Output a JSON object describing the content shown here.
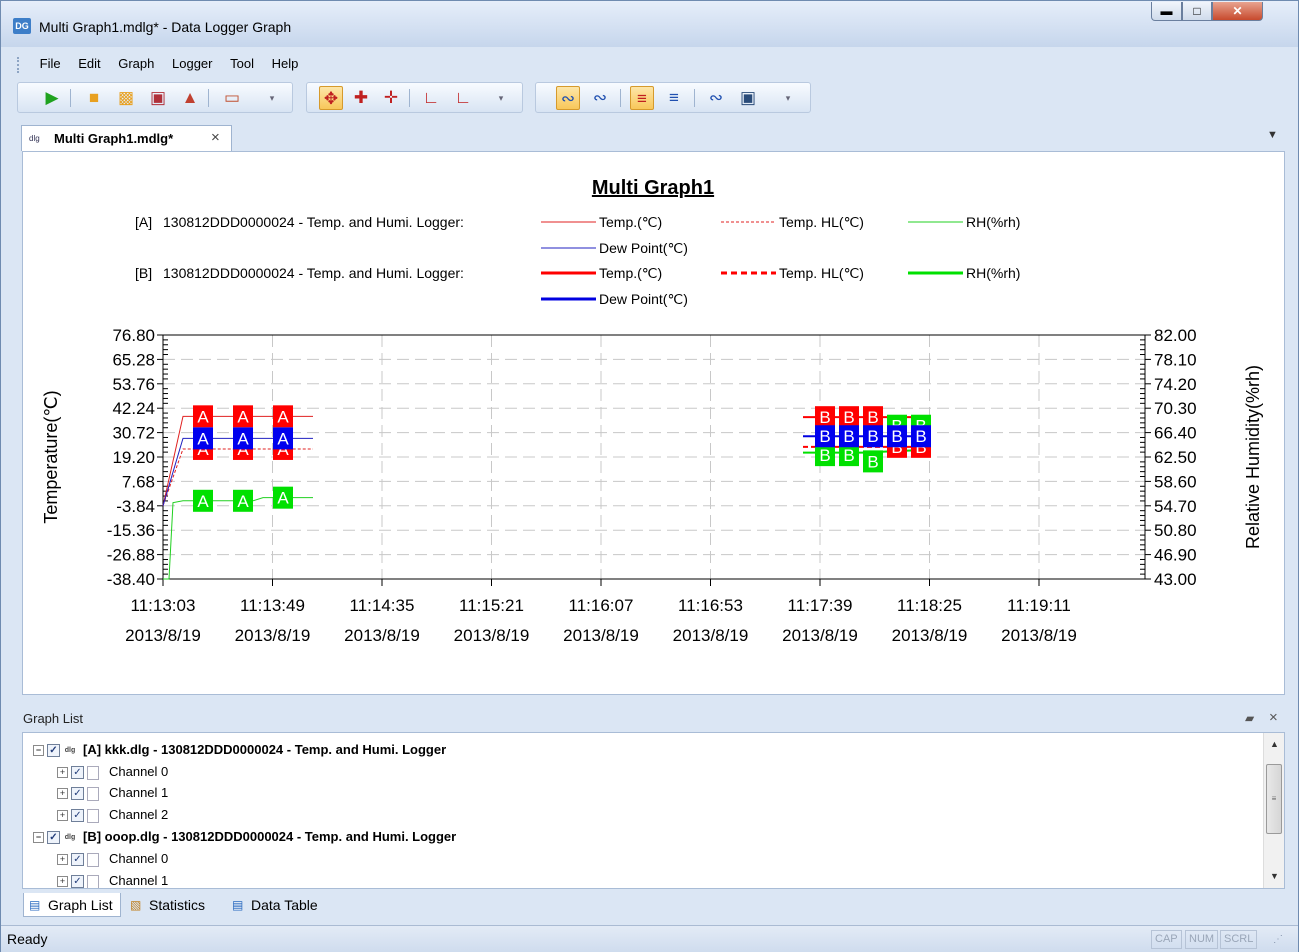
{
  "window": {
    "title": "Multi Graph1.mdlg* - Data Logger Graph",
    "app_icon_text": "DG"
  },
  "menu": [
    "File",
    "Edit",
    "Graph",
    "Logger",
    "Tool",
    "Help"
  ],
  "toolbars": {
    "file_icons": [
      "play-icon",
      "open-folder-icon",
      "open-multi-folder-icon",
      "save-icon",
      "upload-icon",
      "window-icon"
    ],
    "zoom_icons": [
      "move-icon",
      "pan-horizontal-icon",
      "pan-vertical-icon",
      "zoom-in-icon",
      "zoom-out-icon"
    ],
    "view_icons": [
      "graph-style-1-icon",
      "graph-style-2-icon",
      "graph-style-3-icon",
      "graph-style-4-icon",
      "graph-style-5-icon",
      "graph-style-6-icon"
    ]
  },
  "document_tab": {
    "label": "Multi Graph1.mdlg*",
    "icon_text": "dlg"
  },
  "chart_data": {
    "type": "line",
    "title": "Multi Graph1",
    "ylabel": "Temperature(℃)",
    "y2label": "Relative Humidity(%rh)",
    "ylim": [
      -38.4,
      76.8
    ],
    "y2lim": [
      43.0,
      82.0
    ],
    "y_ticks": [
      "76.80",
      "65.28",
      "53.76",
      "42.24",
      "30.72",
      "19.20",
      "7.68",
      "-3.84",
      "-15.36",
      "-26.88",
      "-38.40"
    ],
    "y2_ticks": [
      "82.00",
      "78.10",
      "74.20",
      "70.30",
      "66.40",
      "62.50",
      "58.60",
      "54.70",
      "50.80",
      "46.90",
      "43.00"
    ],
    "x_ticks": [
      {
        "time": "11:13:03",
        "date": "2013/8/19"
      },
      {
        "time": "11:13:49",
        "date": "2013/8/19"
      },
      {
        "time": "11:14:35",
        "date": "2013/8/19"
      },
      {
        "time": "11:15:21",
        "date": "2013/8/19"
      },
      {
        "time": "11:16:07",
        "date": "2013/8/19"
      },
      {
        "time": "11:16:53",
        "date": "2013/8/19"
      },
      {
        "time": "11:17:39",
        "date": "2013/8/19"
      },
      {
        "time": "11:18:25",
        "date": "2013/8/19"
      },
      {
        "time": "11:19:11",
        "date": "2013/8/19"
      }
    ],
    "grid": true,
    "legend_groups": [
      {
        "prefix": "[A]",
        "source": "130812DDD0000024 - Temp. and Humi. Logger:",
        "series": [
          {
            "name": "Temp.(℃)",
            "color": "#e02020",
            "style": "solid"
          },
          {
            "name": "Temp. HL(℃)",
            "color": "#e02020",
            "style": "dashed"
          },
          {
            "name": "RH(%rh)",
            "color": "#20d020",
            "style": "solid"
          },
          {
            "name": "Dew Point(℃)",
            "color": "#2020c0",
            "style": "solid"
          }
        ]
      },
      {
        "prefix": "[B]",
        "source": "130812DDD0000024 - Temp. and Humi. Logger:",
        "series": [
          {
            "name": "Temp.(℃)",
            "color": "#ff0000",
            "style": "solid"
          },
          {
            "name": "Temp. HL(℃)",
            "color": "#ff0000",
            "style": "dashed"
          },
          {
            "name": "RH(%rh)",
            "color": "#00e000",
            "style": "solid"
          },
          {
            "name": "Dew Point(℃)",
            "color": "#0000e0",
            "style": "solid"
          }
        ]
      }
    ],
    "series": [
      {
        "group": "A",
        "name": "Temp.(℃)",
        "color": "#e02020",
        "width": 1,
        "dash": "",
        "x": [
          0,
          20,
          150
        ],
        "y": [
          -3.84,
          38.4,
          38.4
        ]
      },
      {
        "group": "A",
        "name": "Temp. HL(℃)",
        "color": "#e02020",
        "width": 1,
        "dash": "3,2",
        "x": [
          0,
          20,
          150
        ],
        "y": [
          -3.84,
          23.0,
          23.0
        ]
      },
      {
        "group": "A",
        "name": "Dew Point(℃)",
        "color": "#2020c0",
        "width": 1,
        "dash": "",
        "x": [
          0,
          20,
          150
        ],
        "y": [
          -3.84,
          28.0,
          28.0
        ]
      },
      {
        "group": "A",
        "name": "RH(%rh)",
        "color": "#20d020",
        "width": 1,
        "dash": "",
        "x": [
          0,
          6,
          10,
          20,
          90,
          100,
          150
        ],
        "y": [
          43.0,
          43.0,
          55.2,
          55.5,
          55.5,
          56.0,
          56.0
        ]
      },
      {
        "group": "B",
        "name": "Temp.(℃)",
        "color": "#ff0000",
        "width": 2,
        "dash": "",
        "x": [
          640,
          756
        ],
        "y": [
          38.0,
          38.0
        ]
      },
      {
        "group": "B",
        "name": "Temp. HL(℃)",
        "color": "#ff0000",
        "width": 2,
        "dash": "5,3",
        "x": [
          640,
          756
        ],
        "y": [
          24.0,
          24.0
        ]
      },
      {
        "group": "B",
        "name": "Dew Point(℃)",
        "color": "#0000e0",
        "width": 2,
        "dash": "",
        "x": [
          640,
          756
        ],
        "y": [
          29.0,
          29.0
        ]
      },
      {
        "group": "B",
        "name": "RH(%rh)",
        "color": "#00e000",
        "width": 2,
        "dash": "",
        "x": [
          640,
          700,
          756
        ],
        "y": [
          63.2,
          63.2,
          63.6
        ]
      }
    ],
    "markers": [
      {
        "label": "A",
        "color": "#ff0000",
        "axis": "left",
        "x": 40,
        "y": 38.4
      },
      {
        "label": "A",
        "color": "#ff0000",
        "axis": "left",
        "x": 80,
        "y": 38.4
      },
      {
        "label": "A",
        "color": "#ff0000",
        "axis": "left",
        "x": 120,
        "y": 38.4
      },
      {
        "label": "A",
        "color": "#ff0000",
        "axis": "left",
        "x": 40,
        "y": 23.0
      },
      {
        "label": "A",
        "color": "#ff0000",
        "axis": "left",
        "x": 80,
        "y": 23.0
      },
      {
        "label": "A",
        "color": "#ff0000",
        "axis": "left",
        "x": 120,
        "y": 23.0
      },
      {
        "label": "A",
        "color": "#0000ee",
        "axis": "left",
        "x": 40,
        "y": 28.0
      },
      {
        "label": "A",
        "color": "#0000ee",
        "axis": "left",
        "x": 80,
        "y": 28.0
      },
      {
        "label": "A",
        "color": "#0000ee",
        "axis": "left",
        "x": 120,
        "y": 28.0
      },
      {
        "label": "A",
        "color": "#00e000",
        "axis": "right",
        "x": 40,
        "y": 55.5
      },
      {
        "label": "A",
        "color": "#00e000",
        "axis": "right",
        "x": 80,
        "y": 55.5
      },
      {
        "label": "A",
        "color": "#00e000",
        "axis": "right",
        "x": 120,
        "y": 56.0
      },
      {
        "label": "B",
        "color": "#ff0000",
        "axis": "left",
        "x": 662,
        "y": 38.0
      },
      {
        "label": "B",
        "color": "#ff0000",
        "axis": "left",
        "x": 686,
        "y": 38.0
      },
      {
        "label": "B",
        "color": "#ff0000",
        "axis": "left",
        "x": 710,
        "y": 38.0
      },
      {
        "label": "B",
        "color": "#ff0000",
        "axis": "left",
        "x": 734,
        "y": 24.0
      },
      {
        "label": "B",
        "color": "#ff0000",
        "axis": "left",
        "x": 758,
        "y": 24.0
      },
      {
        "label": "B",
        "color": "#00e000",
        "axis": "right",
        "x": 662,
        "y": 62.8
      },
      {
        "label": "B",
        "color": "#00e000",
        "axis": "right",
        "x": 686,
        "y": 62.8
      },
      {
        "label": "B",
        "color": "#00e000",
        "axis": "right",
        "x": 710,
        "y": 61.8
      },
      {
        "label": "B",
        "color": "#00e000",
        "axis": "right",
        "x": 734,
        "y": 67.5
      },
      {
        "label": "B",
        "color": "#00e000",
        "axis": "right",
        "x": 758,
        "y": 67.5
      },
      {
        "label": "B",
        "color": "#0000ee",
        "axis": "left",
        "x": 662,
        "y": 29.0
      },
      {
        "label": "B",
        "color": "#0000ee",
        "axis": "left",
        "x": 686,
        "y": 29.0
      },
      {
        "label": "B",
        "color": "#0000ee",
        "axis": "left",
        "x": 710,
        "y": 29.0
      },
      {
        "label": "B",
        "color": "#0000ee",
        "axis": "left",
        "x": 734,
        "y": 29.0
      },
      {
        "label": "B",
        "color": "#0000ee",
        "axis": "left",
        "x": 758,
        "y": 29.0
      }
    ]
  },
  "graph_list": {
    "title": "Graph List",
    "pin_icon": "pin-icon",
    "items": [
      {
        "label": "[A]  kkk.dlg - 130812DDD0000024 - Temp. and Humi. Logger"
      },
      {
        "label": "Channel 0"
      },
      {
        "label": "Channel 1"
      },
      {
        "label": "Channel 2"
      },
      {
        "label": "[B]  ooop.dlg - 130812DDD0000024 - Temp. and Humi. Logger"
      },
      {
        "label": "Channel 0"
      },
      {
        "label": "Channel 1"
      }
    ]
  },
  "bottom_tabs": [
    "Graph List",
    "Statistics",
    "Data Table"
  ],
  "status": {
    "text": "Ready",
    "indicators": [
      "CAP",
      "NUM",
      "SCRL"
    ]
  }
}
